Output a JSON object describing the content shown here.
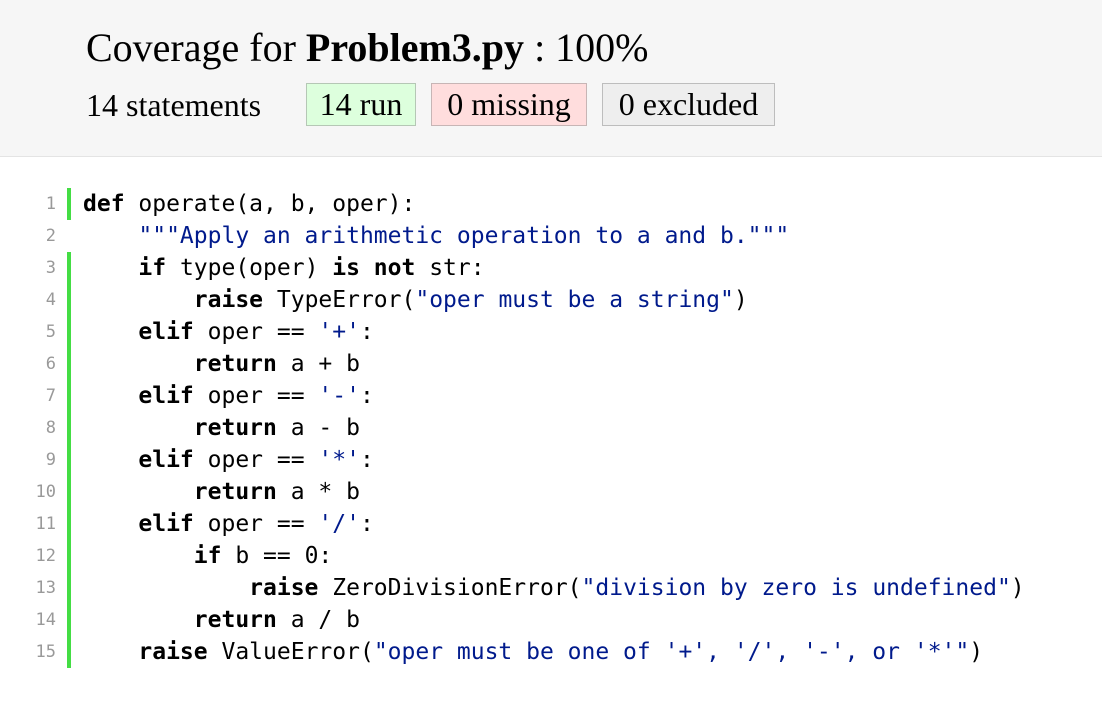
{
  "header": {
    "title_prefix": "Coverage for ",
    "filename": "Problem3.py",
    "title_suffix": " : 100%",
    "statements_text": "14 statements",
    "run_badge": "14 run",
    "missing_badge": "0 missing",
    "excluded_badge": "0 excluded"
  },
  "colors": {
    "run_bar": "#44dd44",
    "run_badge_bg": "#ddffdd",
    "missing_badge_bg": "#ffdddd",
    "excluded_badge_bg": "#eeeeee",
    "string": "#001a8c"
  },
  "source": {
    "lines": [
      {
        "num": "1",
        "status": "run",
        "tokens": [
          {
            "t": "kw",
            "v": "def"
          },
          {
            "t": "n",
            "v": " operate(a, b, oper):"
          }
        ]
      },
      {
        "num": "2",
        "status": "none",
        "tokens": [
          {
            "t": "n",
            "v": "    "
          },
          {
            "t": "str",
            "v": "\"\"\"Apply an arithmetic operation to a and b.\"\"\""
          }
        ]
      },
      {
        "num": "3",
        "status": "run",
        "tokens": [
          {
            "t": "n",
            "v": "    "
          },
          {
            "t": "kw",
            "v": "if"
          },
          {
            "t": "n",
            "v": " type(oper) "
          },
          {
            "t": "kw",
            "v": "is not"
          },
          {
            "t": "n",
            "v": " str:"
          }
        ]
      },
      {
        "num": "4",
        "status": "run",
        "tokens": [
          {
            "t": "n",
            "v": "        "
          },
          {
            "t": "kw",
            "v": "raise"
          },
          {
            "t": "n",
            "v": " TypeError("
          },
          {
            "t": "str",
            "v": "\"oper must be a string\""
          },
          {
            "t": "n",
            "v": ")"
          }
        ]
      },
      {
        "num": "5",
        "status": "run",
        "tokens": [
          {
            "t": "n",
            "v": "    "
          },
          {
            "t": "kw",
            "v": "elif"
          },
          {
            "t": "n",
            "v": " oper == "
          },
          {
            "t": "str",
            "v": "'+'"
          },
          {
            "t": "n",
            "v": ":"
          }
        ]
      },
      {
        "num": "6",
        "status": "run",
        "tokens": [
          {
            "t": "n",
            "v": "        "
          },
          {
            "t": "kw",
            "v": "return"
          },
          {
            "t": "n",
            "v": " a + b"
          }
        ]
      },
      {
        "num": "7",
        "status": "run",
        "tokens": [
          {
            "t": "n",
            "v": "    "
          },
          {
            "t": "kw",
            "v": "elif"
          },
          {
            "t": "n",
            "v": " oper == "
          },
          {
            "t": "str",
            "v": "'-'"
          },
          {
            "t": "n",
            "v": ":"
          }
        ]
      },
      {
        "num": "8",
        "status": "run",
        "tokens": [
          {
            "t": "n",
            "v": "        "
          },
          {
            "t": "kw",
            "v": "return"
          },
          {
            "t": "n",
            "v": " a - b"
          }
        ]
      },
      {
        "num": "9",
        "status": "run",
        "tokens": [
          {
            "t": "n",
            "v": "    "
          },
          {
            "t": "kw",
            "v": "elif"
          },
          {
            "t": "n",
            "v": " oper == "
          },
          {
            "t": "str",
            "v": "'*'"
          },
          {
            "t": "n",
            "v": ":"
          }
        ]
      },
      {
        "num": "10",
        "status": "run",
        "tokens": [
          {
            "t": "n",
            "v": "        "
          },
          {
            "t": "kw",
            "v": "return"
          },
          {
            "t": "n",
            "v": " a * b"
          }
        ]
      },
      {
        "num": "11",
        "status": "run",
        "tokens": [
          {
            "t": "n",
            "v": "    "
          },
          {
            "t": "kw",
            "v": "elif"
          },
          {
            "t": "n",
            "v": " oper == "
          },
          {
            "t": "str",
            "v": "'/'"
          },
          {
            "t": "n",
            "v": ":"
          }
        ]
      },
      {
        "num": "12",
        "status": "run",
        "tokens": [
          {
            "t": "n",
            "v": "        "
          },
          {
            "t": "kw",
            "v": "if"
          },
          {
            "t": "n",
            "v": " b == 0:"
          }
        ]
      },
      {
        "num": "13",
        "status": "run",
        "tokens": [
          {
            "t": "n",
            "v": "            "
          },
          {
            "t": "kw",
            "v": "raise"
          },
          {
            "t": "n",
            "v": " ZeroDivisionError("
          },
          {
            "t": "str",
            "v": "\"division by zero is undefined\""
          },
          {
            "t": "n",
            "v": ")"
          }
        ]
      },
      {
        "num": "14",
        "status": "run",
        "tokens": [
          {
            "t": "n",
            "v": "        "
          },
          {
            "t": "kw",
            "v": "return"
          },
          {
            "t": "n",
            "v": " a / b"
          }
        ]
      },
      {
        "num": "15",
        "status": "run",
        "tokens": [
          {
            "t": "n",
            "v": "    "
          },
          {
            "t": "kw",
            "v": "raise"
          },
          {
            "t": "n",
            "v": " ValueError("
          },
          {
            "t": "str",
            "v": "\"oper must be one of '+', '/', '-', or '*'\""
          },
          {
            "t": "n",
            "v": ")"
          }
        ]
      }
    ]
  }
}
